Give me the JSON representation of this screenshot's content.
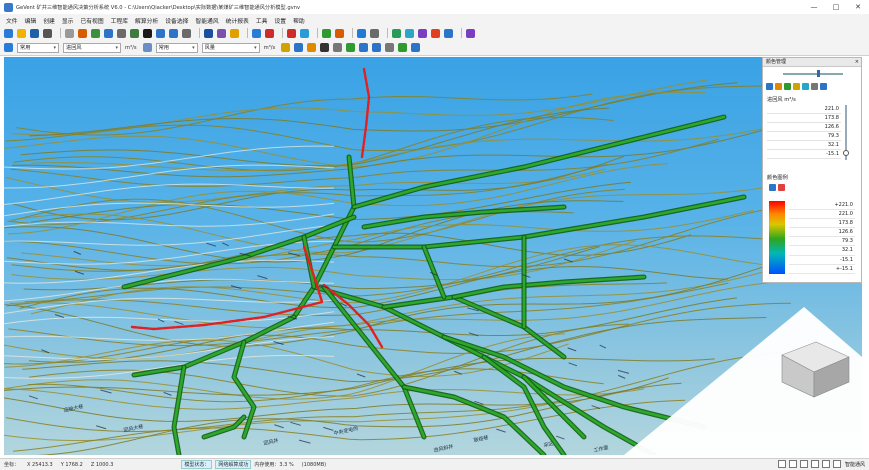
{
  "window": {
    "title": "GeVent 矿井三维智能通风决策分析系统 V6.0 - C:\\Users\\Qiacker\\Desktop\\实际数据\\某煤矿三维智能通风分析模型.gvnv",
    "minimize": "—",
    "maximize": "□",
    "close": "✕"
  },
  "menu": [
    "文件",
    "编辑",
    "创建",
    "显示",
    "已有视图",
    "工程库",
    "解算分析",
    "设备选择",
    "智能通风",
    "统计报表",
    "工具",
    "设置",
    "帮助"
  ],
  "toolbar": {
    "row1_icons": [
      "new-icon",
      "open-icon",
      "save-icon",
      "print-icon",
      "sep",
      "undo-icon",
      "redo-icon",
      "settings-icon",
      "globe-icon",
      "layers-icon",
      "grid-icon",
      "zoom-icon",
      "pan-icon",
      "select-icon",
      "measure-icon",
      "sep",
      "pen-icon",
      "wrench-icon",
      "star-icon",
      "sep",
      "network-icon",
      "link-icon",
      "sep",
      "chart-icon",
      "fan-icon",
      "sep",
      "arrow-icon",
      "refresh-icon",
      "sep",
      "filter-icon",
      "node-icon",
      "sep",
      "earth-icon",
      "pipe-icon",
      "sensor-icon",
      "fire-icon",
      "report-icon",
      "sep",
      "help-icon"
    ],
    "row1_icon_colors": [
      "#2a7ad8",
      "#f0b400",
      "#1f5fa8",
      "#555",
      "#999",
      "#999",
      "#d95b00",
      "#3c8f3c",
      "#2b74c8",
      "#6b6b6b",
      "#3f7a3f",
      "#1a1a1a",
      "#2b74c8",
      "#2b74c8",
      "#6a6a6a",
      "#999",
      "#1a4fa0",
      "#7a4faf",
      "#e0a000",
      "#999",
      "#2a7ad8",
      "#d12a2a",
      "#999",
      "#d12a2a",
      "#2b9bd8",
      "#999",
      "#2f9a2f",
      "#d95b00",
      "#999",
      "#1f7ad8",
      "#6b6b6b",
      "#999",
      "#2a9a5a",
      "#2aa6c8",
      "#7a3fbf",
      "#e04020",
      "#2b74c8",
      "#999",
      "#7a3fbf"
    ],
    "row2": {
      "style_select": "常用",
      "field_select": "进回风",
      "unit1": "m³/s",
      "style_select2": "常用",
      "wind_select": "风量",
      "unit2": "m³/s"
    },
    "row2_icons": [
      "frame-icon",
      "camera-icon",
      "gear-icon",
      "circle-icon",
      "grid-icon",
      "house-icon",
      "list-icon",
      "layout-icon",
      "copy-icon",
      "recycle-icon",
      "table-icon"
    ],
    "row2_icon_colors": [
      "#d1a300",
      "#2b74c8",
      "#e08a00",
      "#333",
      "#777",
      "#2f9a2f",
      "#2b74c8",
      "#2b74c8",
      "#777",
      "#2f9a2f",
      "#2b74c8"
    ]
  },
  "panel": {
    "title": "颜色管理",
    "close": "×",
    "field": "进回风 m³/s",
    "values": [
      "221.0",
      "173.8",
      "126.6",
      "79.3",
      "32.1",
      "-15.1"
    ],
    "legend_title": "颜色图例",
    "legend_values": [
      "+221.0",
      "221.0",
      "173.8",
      "126.6",
      "79.3",
      "32.1",
      "-15.1",
      "+-15.1"
    ]
  },
  "status": {
    "label": "坐标：",
    "x": "X 25413.3",
    "y": "Y 1768.2",
    "z": "Z 1000.3",
    "model_state": "模型状态：",
    "solve_state": "网络解算成功",
    "memory": "内存使用：3.3 %",
    "memory_size": "(1080MB)",
    "brand": "智能通风"
  },
  "scene_labels": [
    "运输大巷",
    "回风大巷",
    "进风斜井",
    "采区",
    "工作面",
    "回风井",
    "中央变电所",
    "联络巷"
  ]
}
